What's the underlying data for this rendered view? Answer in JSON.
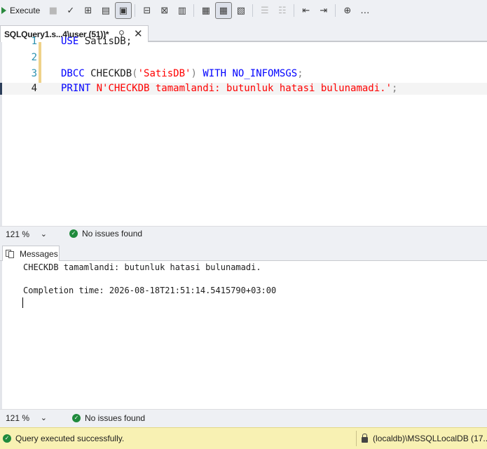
{
  "toolbar": {
    "execute_label": "Execute",
    "buttons": [
      {
        "icon": "stop-icon",
        "glyph": "■"
      },
      {
        "icon": "parse-check-icon",
        "glyph": "✓"
      },
      {
        "icon": "query-plan-icon",
        "glyph": "⊞"
      },
      {
        "icon": "query-designer-icon",
        "glyph": "▤"
      },
      {
        "icon": "results-grid-icon",
        "glyph": "▣"
      },
      {
        "icon": "include-plan-icon",
        "glyph": "⊟"
      },
      {
        "icon": "live-stats-icon",
        "glyph": "⊠"
      },
      {
        "icon": "client-stats-icon",
        "glyph": "▥"
      },
      {
        "icon": "results-to-text-icon",
        "glyph": "▦"
      },
      {
        "icon": "results-to-grid-icon",
        "glyph": "▦"
      },
      {
        "icon": "results-to-file-icon",
        "glyph": "▧"
      },
      {
        "icon": "comment-icon",
        "glyph": "☰"
      },
      {
        "icon": "uncomment-icon",
        "glyph": "☷"
      },
      {
        "icon": "outdent-icon",
        "glyph": "⇤"
      },
      {
        "icon": "indent-icon",
        "glyph": "⇥"
      },
      {
        "icon": "specify-values-icon",
        "glyph": "⊕"
      },
      {
        "icon": "more-icon",
        "glyph": "…"
      }
    ]
  },
  "tab": {
    "title": "SQLQuery1.s...4\\user (51))*",
    "pin_glyph": "⚲",
    "close_glyph": "✕"
  },
  "editor": {
    "lines": [
      {
        "number": "1",
        "text": "USE SatisDB;"
      },
      {
        "number": "2",
        "text": ""
      },
      {
        "number": "3",
        "text": "DBCC CHECKDB('SatisDB') WITH NO_INFOMSGS;"
      },
      {
        "number": "4",
        "text": "PRINT N'CHECKDB tamamlandi: butunluk hatasi bulunamadi.';"
      }
    ],
    "tokens": {
      "use_kw": "USE",
      "use_rest": " SatisDB;",
      "dbcc_kw": "DBCC",
      "checkdb": " CHECKDB",
      "paren_open": "(",
      "db_str": "'SatisDB'",
      "paren_close": ")",
      "with_kw": " WITH",
      "noinfo_kw": " NO_INFOMSGS",
      "semi": ";",
      "print_kw": "PRINT",
      "msg_str": " N'CHECKDB tamamlandi: butunluk hatasi bulunamadi.'",
      "semi2": ";"
    },
    "current_line": 4
  },
  "editor_status": {
    "zoom": "121 %",
    "issues": "No issues found"
  },
  "results_tabs": {
    "messages_label": "Messages"
  },
  "messages": {
    "line1": "CHECKDB tamamlandi: butunluk hatasi bulunamadi.",
    "line2": "",
    "line3": "Completion time: 2026-08-18T21:51:14.5415790+03:00"
  },
  "results_status": {
    "zoom": "121 %",
    "issues": "No issues found"
  },
  "exec_status": {
    "message": "Query executed successfully.",
    "connection": "(localdb)\\MSSQLLocalDB (17..."
  },
  "colors": {
    "keyword": "#0000ff",
    "string": "#ff0000",
    "line_number": "#2b91af",
    "success": "#1f8a3c",
    "status_bar": "#f8f1b3"
  }
}
